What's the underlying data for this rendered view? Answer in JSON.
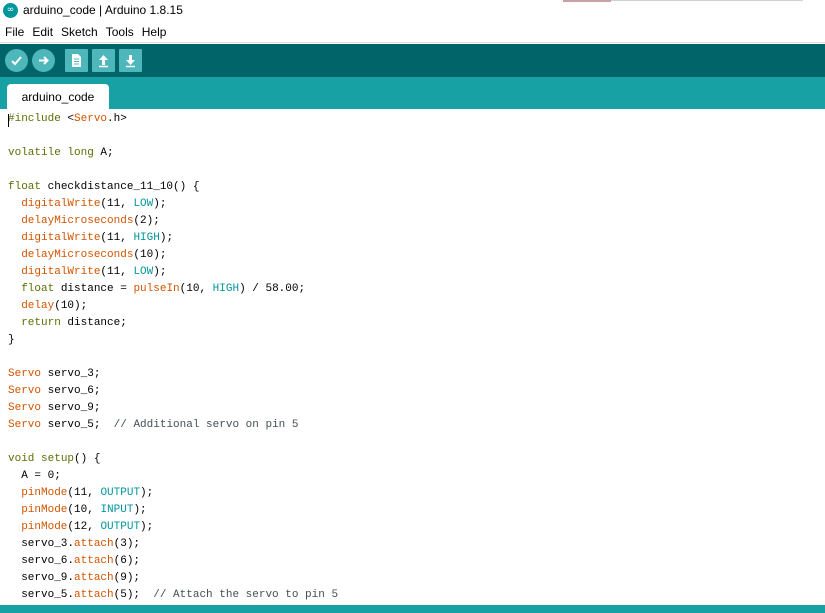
{
  "window": {
    "title": "arduino_code | Arduino 1.8.15",
    "app_icon": "∞"
  },
  "menu": [
    "File",
    "Edit",
    "Sketch",
    "Tools",
    "Help"
  ],
  "toolbar": {
    "buttons": [
      {
        "name": "verify-button",
        "icon": "checkmark-icon"
      },
      {
        "name": "upload-button",
        "icon": "arrow-right-icon"
      },
      {
        "name": "new-button",
        "icon": "new-file-icon"
      },
      {
        "name": "open-button",
        "icon": "arrow-up-icon"
      },
      {
        "name": "save-button",
        "icon": "arrow-down-icon"
      }
    ]
  },
  "tabs": [
    "arduino_code"
  ],
  "editor": {
    "lines": [
      [
        [
          "pre",
          "#include "
        ],
        [
          "",
          "<"
        ],
        [
          "lib",
          "Servo"
        ],
        [
          "",
          ".h>"
        ]
      ],
      [],
      [
        [
          "type",
          "volatile"
        ],
        [
          "",
          " "
        ],
        [
          "type",
          "long"
        ],
        [
          "",
          " A;"
        ]
      ],
      [],
      [
        [
          "type",
          "float"
        ],
        [
          "",
          " checkdistance_11_10() {"
        ]
      ],
      [
        [
          "",
          "  "
        ],
        [
          "func",
          "digitalWrite"
        ],
        [
          "",
          "(11, "
        ],
        [
          "const",
          "LOW"
        ],
        [
          "",
          ");"
        ]
      ],
      [
        [
          "",
          "  "
        ],
        [
          "func",
          "delayMicroseconds"
        ],
        [
          "",
          "(2);"
        ]
      ],
      [
        [
          "",
          "  "
        ],
        [
          "func",
          "digitalWrite"
        ],
        [
          "",
          "(11, "
        ],
        [
          "const",
          "HIGH"
        ],
        [
          "",
          ");"
        ]
      ],
      [
        [
          "",
          "  "
        ],
        [
          "func",
          "delayMicroseconds"
        ],
        [
          "",
          "(10);"
        ]
      ],
      [
        [
          "",
          "  "
        ],
        [
          "func",
          "digitalWrite"
        ],
        [
          "",
          "(11, "
        ],
        [
          "const",
          "LOW"
        ],
        [
          "",
          ");"
        ]
      ],
      [
        [
          "",
          "  "
        ],
        [
          "type",
          "float"
        ],
        [
          "",
          " distance = "
        ],
        [
          "func",
          "pulseIn"
        ],
        [
          "",
          "(10, "
        ],
        [
          "const",
          "HIGH"
        ],
        [
          "",
          ") / 58.00;"
        ]
      ],
      [
        [
          "",
          "  "
        ],
        [
          "func",
          "delay"
        ],
        [
          "",
          "(10);"
        ]
      ],
      [
        [
          "",
          "  "
        ],
        [
          "ctrl",
          "return"
        ],
        [
          "",
          " distance;"
        ]
      ],
      [
        [
          "",
          "}"
        ]
      ],
      [],
      [
        [
          "lib",
          "Servo"
        ],
        [
          "",
          " servo_3;"
        ]
      ],
      [
        [
          "lib",
          "Servo"
        ],
        [
          "",
          " servo_6;"
        ]
      ],
      [
        [
          "lib",
          "Servo"
        ],
        [
          "",
          " servo_9;"
        ]
      ],
      [
        [
          "lib",
          "Servo"
        ],
        [
          "",
          " servo_5;  "
        ],
        [
          "comment",
          "// Additional servo on pin 5"
        ]
      ],
      [],
      [
        [
          "type",
          "void"
        ],
        [
          "",
          " "
        ],
        [
          "ctrl",
          "setup"
        ],
        [
          "",
          "() {"
        ]
      ],
      [
        [
          "",
          "  A = 0;"
        ]
      ],
      [
        [
          "",
          "  "
        ],
        [
          "func",
          "pinMode"
        ],
        [
          "",
          "(11, "
        ],
        [
          "const",
          "OUTPUT"
        ],
        [
          "",
          ");"
        ]
      ],
      [
        [
          "",
          "  "
        ],
        [
          "func",
          "pinMode"
        ],
        [
          "",
          "(10, "
        ],
        [
          "const",
          "INPUT"
        ],
        [
          "",
          ");"
        ]
      ],
      [
        [
          "",
          "  "
        ],
        [
          "func",
          "pinMode"
        ],
        [
          "",
          "(12, "
        ],
        [
          "const",
          "OUTPUT"
        ],
        [
          "",
          ");"
        ]
      ],
      [
        [
          "",
          "  servo_3."
        ],
        [
          "func",
          "attach"
        ],
        [
          "",
          "(3);"
        ]
      ],
      [
        [
          "",
          "  servo_6."
        ],
        [
          "func",
          "attach"
        ],
        [
          "",
          "(6);"
        ]
      ],
      [
        [
          "",
          "  servo_9."
        ],
        [
          "func",
          "attach"
        ],
        [
          "",
          "(9);"
        ]
      ],
      [
        [
          "",
          "  servo_5."
        ],
        [
          "func",
          "attach"
        ],
        [
          "",
          "(5);  "
        ],
        [
          "comment",
          "// Attach the servo to pin 5"
        ]
      ]
    ]
  }
}
